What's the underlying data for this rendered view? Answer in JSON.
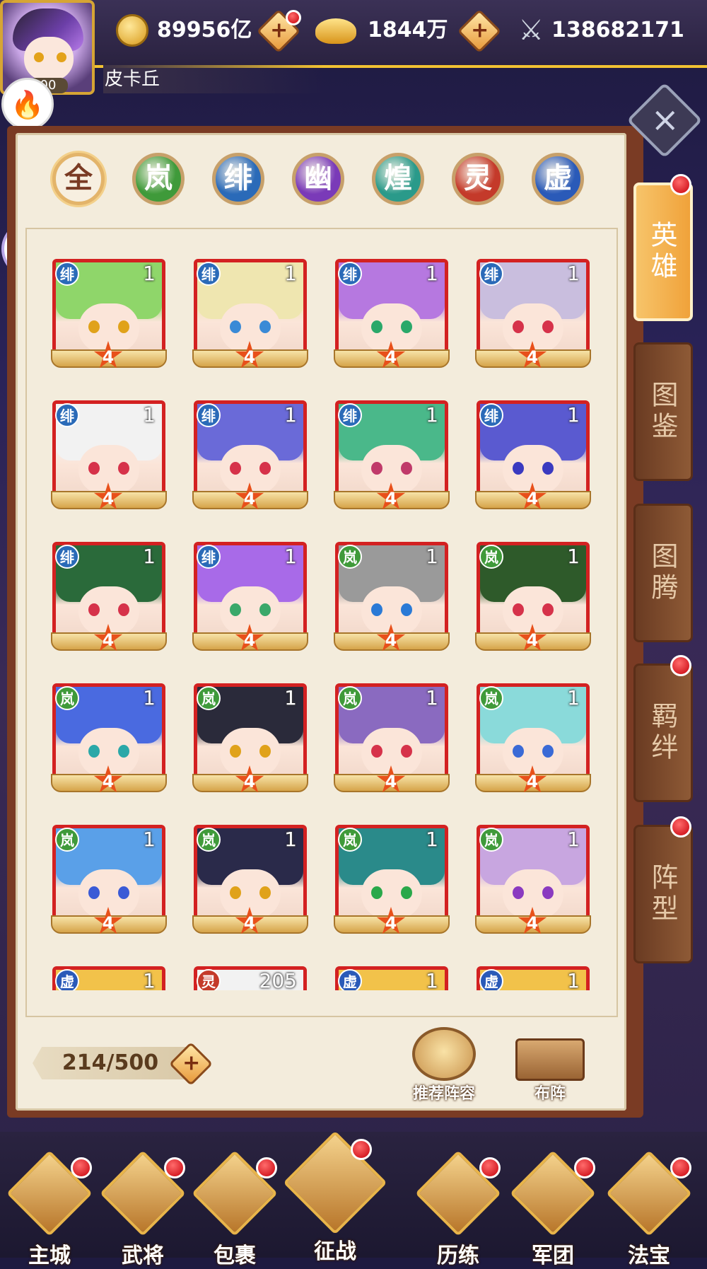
{
  "player": {
    "name": "皮卡丘",
    "level": "00"
  },
  "resources": [
    {
      "name": "coins",
      "icon": "gold-coin-icon",
      "value": "89956亿",
      "has_plus": true,
      "red_dot": true
    },
    {
      "name": "ingots",
      "icon": "gold-ingot-icon",
      "value": "1844万",
      "has_plus": true,
      "red_dot": false
    },
    {
      "name": "power",
      "icon": "crossed-swords-icon",
      "value": "138682171",
      "has_plus": false,
      "red_dot": false
    }
  ],
  "factions": [
    {
      "label": "全",
      "color": "#f3ecdc",
      "text": "#7a3b24",
      "selected": true
    },
    {
      "label": "岚",
      "color": "#3f9a3a"
    },
    {
      "label": "绯",
      "color": "#2a6ab8"
    },
    {
      "label": "幽",
      "color": "#7a3ab8"
    },
    {
      "label": "煌",
      "color": "#2a9a8a"
    },
    {
      "label": "灵",
      "color": "#c43a2a"
    },
    {
      "label": "虚",
      "color": "#2a5ab8"
    }
  ],
  "side_tabs": [
    {
      "label": "英雄",
      "active": true,
      "red_dot": true
    },
    {
      "label": "图鉴",
      "active": false,
      "red_dot": false
    },
    {
      "label": "图腾",
      "active": false,
      "red_dot": false
    },
    {
      "label": "羁绊",
      "active": false,
      "red_dot": true
    },
    {
      "label": "阵型",
      "active": false,
      "red_dot": true
    }
  ],
  "heroes": [
    {
      "faction": "绯",
      "level": "1",
      "stars": "4",
      "hair": "#8fd66a",
      "eye": "#e0a21a"
    },
    {
      "faction": "绯",
      "level": "1",
      "stars": "4",
      "hair": "#efe6b0",
      "eye": "#3a8ad6"
    },
    {
      "faction": "绯",
      "level": "1",
      "stars": "4",
      "hair": "#b678e0",
      "eye": "#2aa86a"
    },
    {
      "faction": "绯",
      "level": "1",
      "stars": "4",
      "hair": "#c9bede",
      "eye": "#d6324a"
    },
    {
      "faction": "绯",
      "level": "1",
      "stars": "4",
      "hair": "#f2f2f2",
      "eye": "#d6324a"
    },
    {
      "faction": "绯",
      "level": "1",
      "stars": "4",
      "hair": "#6a6ad8",
      "eye": "#d6324a"
    },
    {
      "faction": "绯",
      "level": "1",
      "stars": "4",
      "hair": "#4ab88a",
      "eye": "#c03a6a"
    },
    {
      "faction": "绯",
      "level": "1",
      "stars": "4",
      "hair": "#5a5ad0",
      "eye": "#3a3ac0"
    },
    {
      "faction": "绯",
      "level": "1",
      "stars": "4",
      "hair": "#2a6a3a",
      "eye": "#d6324a"
    },
    {
      "faction": "绯",
      "level": "1",
      "stars": "4",
      "hair": "#a86ae8",
      "eye": "#3aa86a"
    },
    {
      "faction": "岚",
      "level": "1",
      "stars": "4",
      "hair": "#9a9a9a",
      "eye": "#2a7ad6"
    },
    {
      "faction": "岚",
      "level": "1",
      "stars": "4",
      "hair": "#2e5a2a",
      "eye": "#d6324a"
    },
    {
      "faction": "岚",
      "level": "1",
      "stars": "4",
      "hair": "#4a6ae0",
      "eye": "#2aa8a8"
    },
    {
      "faction": "岚",
      "level": "1",
      "stars": "4",
      "hair": "#2a2a3a",
      "eye": "#e0a21a"
    },
    {
      "faction": "岚",
      "level": "1",
      "stars": "4",
      "hair": "#8a6ac0",
      "eye": "#d6324a"
    },
    {
      "faction": "岚",
      "level": "1",
      "stars": "4",
      "hair": "#8adada",
      "eye": "#3a6ad6"
    },
    {
      "faction": "岚",
      "level": "1",
      "stars": "4",
      "hair": "#5aa0e8",
      "eye": "#3a5ad6"
    },
    {
      "faction": "岚",
      "level": "1",
      "stars": "4",
      "hair": "#2a2a4a",
      "eye": "#e0a21a"
    },
    {
      "faction": "岚",
      "level": "1",
      "stars": "4",
      "hair": "#2a8a8a",
      "eye": "#2aa84a"
    },
    {
      "faction": "岚",
      "level": "1",
      "stars": "4",
      "hair": "#c8a6e0",
      "eye": "#8a3ac0"
    },
    {
      "faction": "虚",
      "level": "1",
      "stars": "",
      "hair": "#f2c24a",
      "eye": "#d6324a"
    },
    {
      "faction": "灵",
      "level": "205",
      "stars": "",
      "hair": "#f2f2f2",
      "eye": "#d6324a"
    },
    {
      "faction": "虚",
      "level": "1",
      "stars": "",
      "hair": "#f2c24a",
      "eye": "#d6324a"
    },
    {
      "faction": "虚",
      "level": "1",
      "stars": "",
      "hair": "#f2c24a",
      "eye": "#d6324a"
    }
  ],
  "hero_count": "214/500",
  "actions": {
    "recommend_label": "推荐阵容",
    "formation_label": "布阵"
  },
  "nav": [
    {
      "label": "主城",
      "icon": "castle-icon",
      "red_dot": true
    },
    {
      "label": "武将",
      "icon": "general-helmet-icon",
      "red_dot": true
    },
    {
      "label": "包裹",
      "icon": "bag-icon",
      "red_dot": true
    },
    {
      "label": "征战",
      "icon": "winged-sword-icon",
      "red_dot": true,
      "large": true
    },
    {
      "label": "历练",
      "icon": "training-icon",
      "red_dot": true
    },
    {
      "label": "军团",
      "icon": "legion-crest-icon",
      "red_dot": true
    },
    {
      "label": "法宝",
      "icon": "treasure-icon",
      "red_dot": true
    }
  ]
}
